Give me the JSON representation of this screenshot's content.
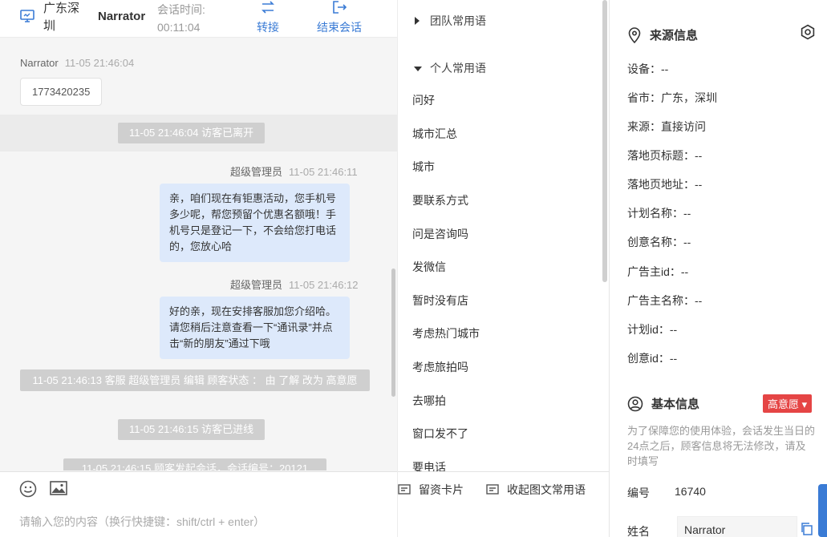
{
  "chat": {
    "header": {
      "location": "广东深圳",
      "visitor_name": "Narrator",
      "time_label": "会话时间:",
      "time_value": "00:11:04",
      "transfer_label": "转接",
      "end_label": "结束会话"
    },
    "messages": [
      {
        "sender": "Narrator",
        "time": "11-05 21:46:04",
        "text": "1773420235"
      },
      {
        "system": "11-05 21:46:04 访客已离开"
      },
      {
        "sender": "超级管理员",
        "time": "11-05 21:46:11",
        "text": "亲，咱们现在有钜惠活动，您手机号多少呢，帮您预留个优惠名额哦！手机号只是登记一下，不会给您打电话的，您放心哈"
      },
      {
        "sender": "超级管理员",
        "time": "11-05 21:46:12",
        "text": "好的亲，现在安排客服加您介绍哈。请您稍后注意查看一下“通讯录”并点击“新的朋友”通过下哦"
      },
      {
        "system": "11-05 21:46:13 客服 超级管理员 编辑 顾客状态 ： 由 了解 改为 高意愿"
      },
      {
        "system": "11-05 21:46:15 访客已进线"
      },
      {
        "system": "11-05 21:46:15 顾客发起会话，会话编号：20121"
      }
    ],
    "input_placeholder": "请输入您的内容（换行快捷键：shift/ctrl + enter）"
  },
  "phrases": {
    "team_group": "团队常用语",
    "personal_group": "个人常用语",
    "items": [
      "问好",
      "城市汇总",
      "城市",
      "要联系方式",
      "问是咨询吗",
      "发微信",
      "暂时没有店",
      "考虑热门城市",
      "考虑旅拍吗",
      "去哪拍",
      "窗口发不了",
      "要电话"
    ],
    "footer_card": "留资卡片",
    "footer_collapse": "收起图文常用语"
  },
  "info": {
    "source_title": "来源信息",
    "source_rows": [
      "设备：--",
      "省市：广东，深圳",
      "来源：直接访问",
      "落地页标题：--",
      "落地页地址：--",
      "计划名称：--",
      "创意名称：--",
      "广告主id：--",
      "广告主名称：--",
      "计划id：--",
      "创意id：--"
    ],
    "basic_title": "基本信息",
    "intent_badge": "高意愿",
    "notice": "为了保障您的使用体验，会话发生当日的24点之后，顾客信息将无法修改，请及时填写",
    "id_label": "编号",
    "id_value": "16740",
    "name_label": "姓名",
    "name_value": "Narrator"
  },
  "colors": {
    "accent": "#3a7bd5",
    "badge": "#e54545",
    "bubble_blue": "#dde9fb"
  }
}
